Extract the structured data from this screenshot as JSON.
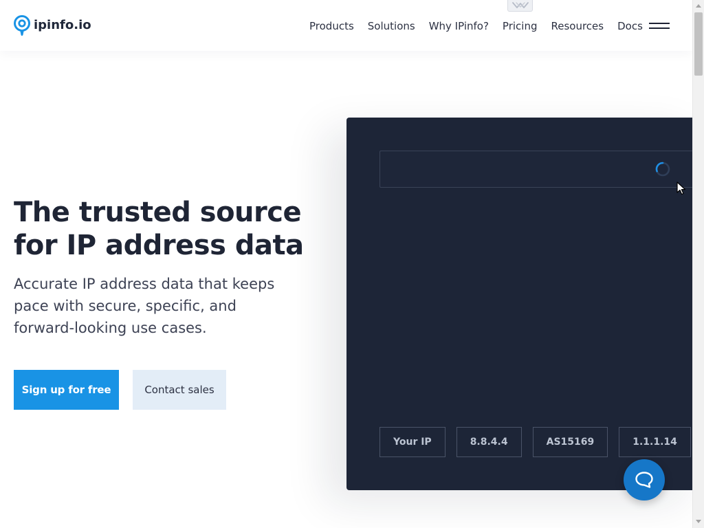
{
  "brand": {
    "name": "ipinfo.io",
    "logo_icon": "location-pin-icon",
    "accent_color": "#1993e5"
  },
  "nav": {
    "items": [
      {
        "label": "Products"
      },
      {
        "label": "Solutions"
      },
      {
        "label": "Why IPinfo?"
      },
      {
        "label": "Pricing"
      },
      {
        "label": "Resources"
      },
      {
        "label": "Docs"
      }
    ],
    "menu_icon": "hamburger-menu-icon",
    "collapsed_tab_icon": "chevron-down-icon"
  },
  "hero": {
    "title": "The trusted source for IP address data",
    "subtitle": "Accurate IP address data that keeps pace with secure, specific, and forward-looking use cases.",
    "primary_cta": "Sign up for free",
    "secondary_cta": "Contact sales"
  },
  "lookup": {
    "input_value": "",
    "status": "loading",
    "spinner_icon": "loading-spinner-icon",
    "panel_color": "#1d2537",
    "chips": [
      {
        "label": "Your IP"
      },
      {
        "label": "8.8.4.4"
      },
      {
        "label": "AS15169"
      },
      {
        "label": "1.1.1.14"
      },
      {
        "label": ""
      }
    ]
  },
  "chat": {
    "icon": "chat-bubble-icon",
    "color": "#1677c8"
  },
  "colors": {
    "heading": "#1f2535",
    "body_text": "#3d4254",
    "secondary_button_bg": "#e3edf7",
    "chip_border": "#4b5469"
  }
}
